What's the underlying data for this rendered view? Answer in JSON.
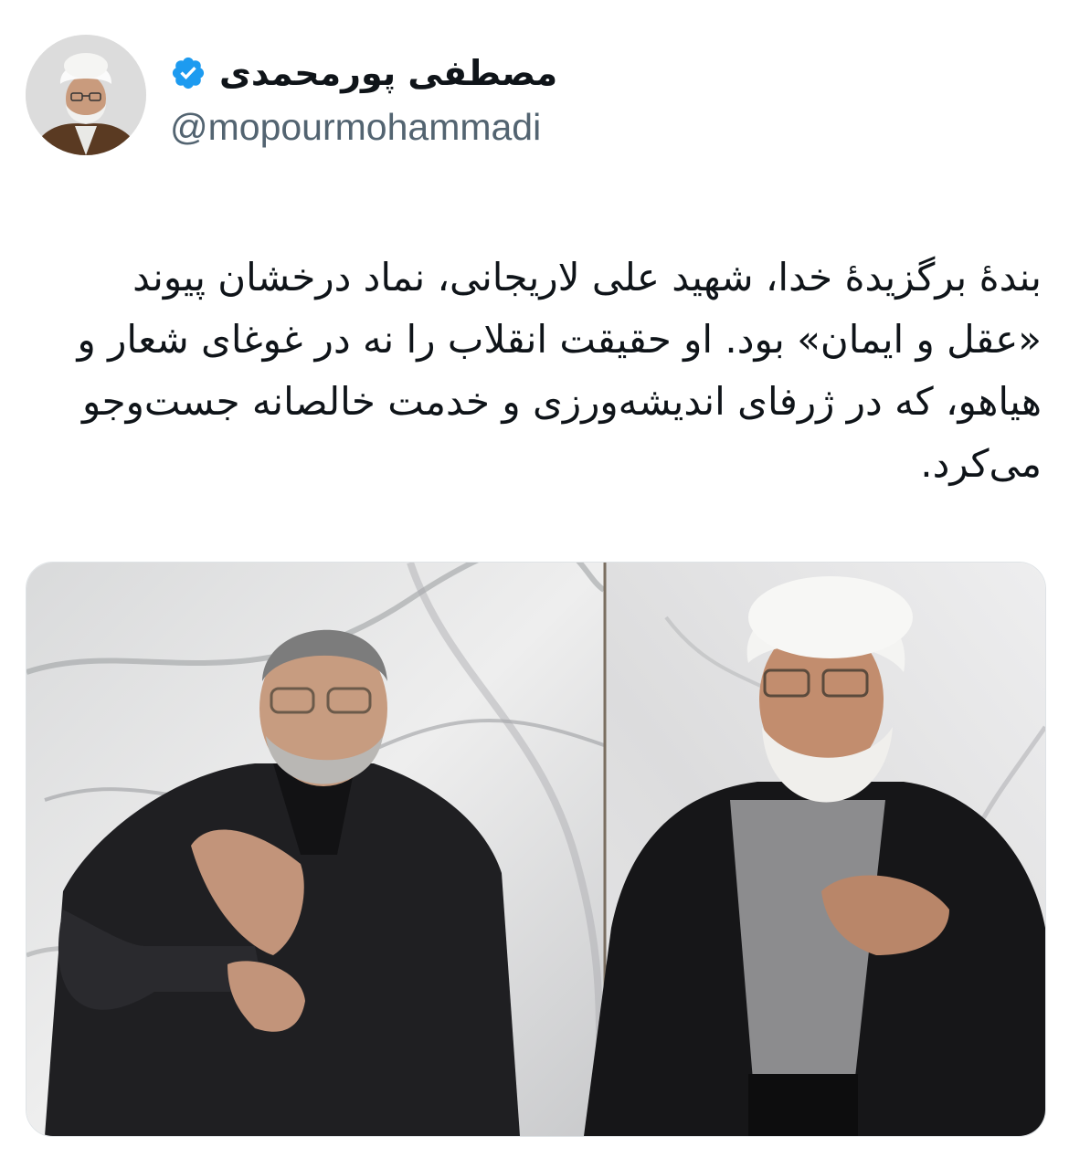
{
  "tweet": {
    "author": {
      "display_name": "مصطفی پورمحمدی",
      "handle": "@mopourmohammadi",
      "verified": true,
      "verified_badge_icon": "verified-badge-icon",
      "verified_color": "#1d9bf0"
    },
    "text": "بندهٔ برگزیدهٔ خدا، شهید علی لاریجانی، نماد درخشان پیوند «عقل و ایمان» بود. او حقیقت انقلاب را نه در غوغای شعار و هیاهو، که در ژرفای اندیشه‌ورزی و خدمت خالصانه جست‌وجو می‌کرد."
  },
  "colors": {
    "text_primary": "#0f1419",
    "text_secondary": "#536471",
    "accent": "#1d9bf0"
  }
}
